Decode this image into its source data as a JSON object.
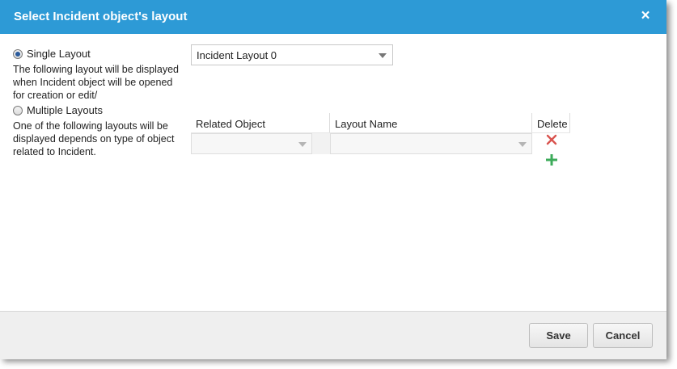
{
  "dialog": {
    "title": "Select Incident object's layout",
    "close_icon": "×"
  },
  "single_layout": {
    "label": "Single Layout",
    "checked": true,
    "description_lines": [
      "The following layout will be displayed",
      "when Incident object will be opened",
      "for creation or edit/"
    ],
    "selected_layout": "Incident Layout 0"
  },
  "multiple_layouts": {
    "label": "Multiple Layouts",
    "checked": false,
    "description_lines": [
      "One of the following layouts will be",
      "displayed depends on type of object",
      "related to Incident."
    ],
    "table": {
      "headers": [
        "Related Object",
        "Layout Name",
        "Delete"
      ],
      "rows": [
        {
          "related_object": "",
          "layout_name": ""
        }
      ]
    }
  },
  "icons": {
    "delete": "delete-x-icon",
    "add": "add-plus-icon"
  },
  "colors": {
    "titlebar": "#2d9ad6",
    "delete_icon": "#d9534f",
    "add_icon": "#3cab5a"
  },
  "footer": {
    "save_label": "Save",
    "cancel_label": "Cancel"
  }
}
